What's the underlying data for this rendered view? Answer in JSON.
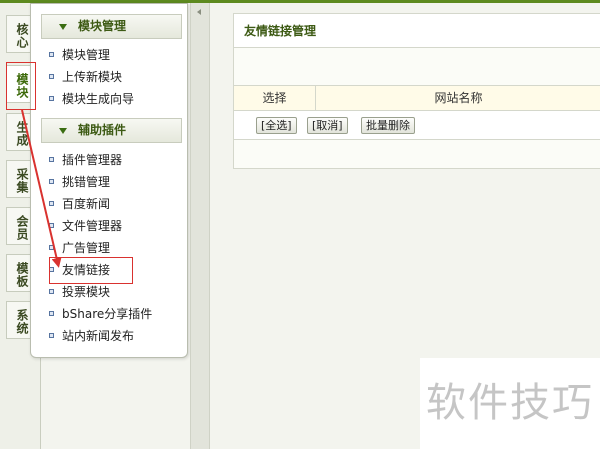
{
  "left_tabs": [
    "核心",
    "模块",
    "生成",
    "采集",
    "会员",
    "模板",
    "系统"
  ],
  "menu": {
    "sections": [
      {
        "title": "模块管理",
        "items": [
          "模块管理",
          "上传新模块",
          "模块生成向导"
        ]
      },
      {
        "title": "辅助插件",
        "items": [
          "插件管理器",
          "挑错管理",
          "百度新闻",
          "文件管理器",
          "广告管理",
          "友情链接",
          "投票模块",
          "bShare分享插件",
          "站内新闻发布"
        ]
      }
    ]
  },
  "main": {
    "title": "友情链接管理",
    "col_select": "选择",
    "col_site_name": "网站名称",
    "buttons": {
      "select_all": "[全选]",
      "cancel": "[取消]",
      "batch_delete": "批量删除"
    }
  },
  "watermark": "软件技巧",
  "colors": {
    "accent_green": "#5d8a1f",
    "annotation_red": "#d9322f"
  },
  "icons": [
    "triangle-down-icon",
    "square-bullet-icon",
    "collapse-arrow-icon"
  ]
}
